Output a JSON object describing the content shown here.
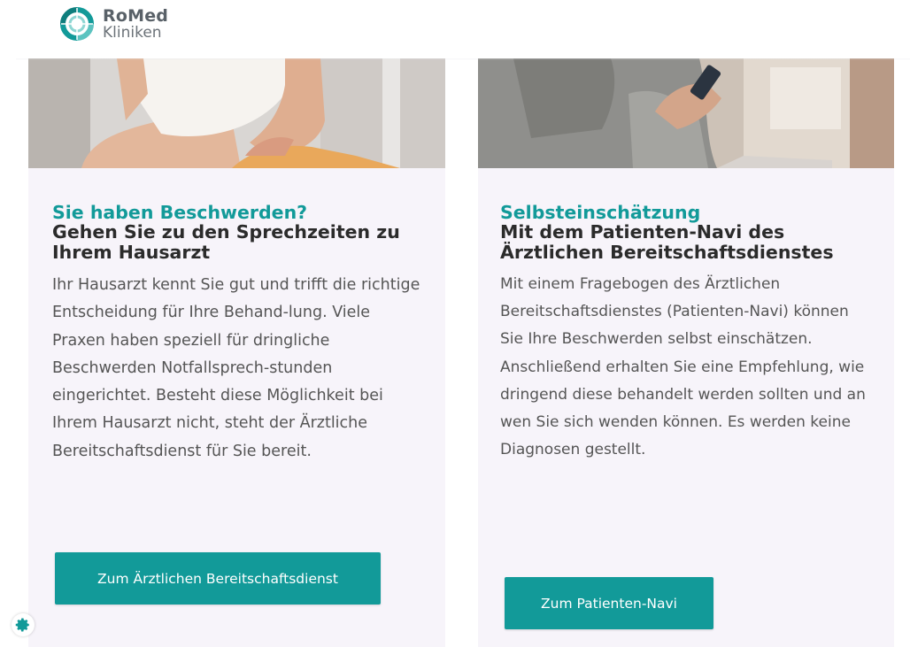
{
  "header": {
    "logo_title": "RoMed",
    "logo_subtitle": "Kliniken",
    "brand_color": "#129a99"
  },
  "cards": [
    {
      "kicker": "Sie haben Beschwerden?",
      "heading": "Gehen Sie zu den Sprechzeiten zu Ihrem Hausarzt",
      "text": "Ihr Hausarzt kennt Sie gut und trifft die richtige Entscheidung für Ihre Behand-lung. Viele Praxen haben speziell für dringliche Beschwerden Notfallsprech-stunden eingerichtet. Besteht diese Möglichkeit bei Ihrem Hausarzt nicht, steht der Ärztliche Bereitschaftsdienst für Sie bereit.",
      "button_label": "Zum Ärztlichen Bereitschaftsdienst"
    },
    {
      "kicker": "Selbsteinschätzung",
      "heading": "Mit dem Patienten-Navi des Ärztlichen Bereitschaftsdienstes",
      "text": "Mit einem Fragebogen des Ärztlichen Bereitschaftsdienstes (Patienten-Navi) können Sie Ihre Beschwerden selbst einschätzen. Anschließend erhalten Sie eine Empfehlung, wie dringend diese behandelt werden sollten und an wen Sie sich wenden können. Es werden keine Diagnosen gestellt.",
      "button_label": "Zum Patienten-Navi"
    }
  ],
  "icons": {
    "logo": "romed-logo-icon",
    "settings": "gear-icon"
  }
}
